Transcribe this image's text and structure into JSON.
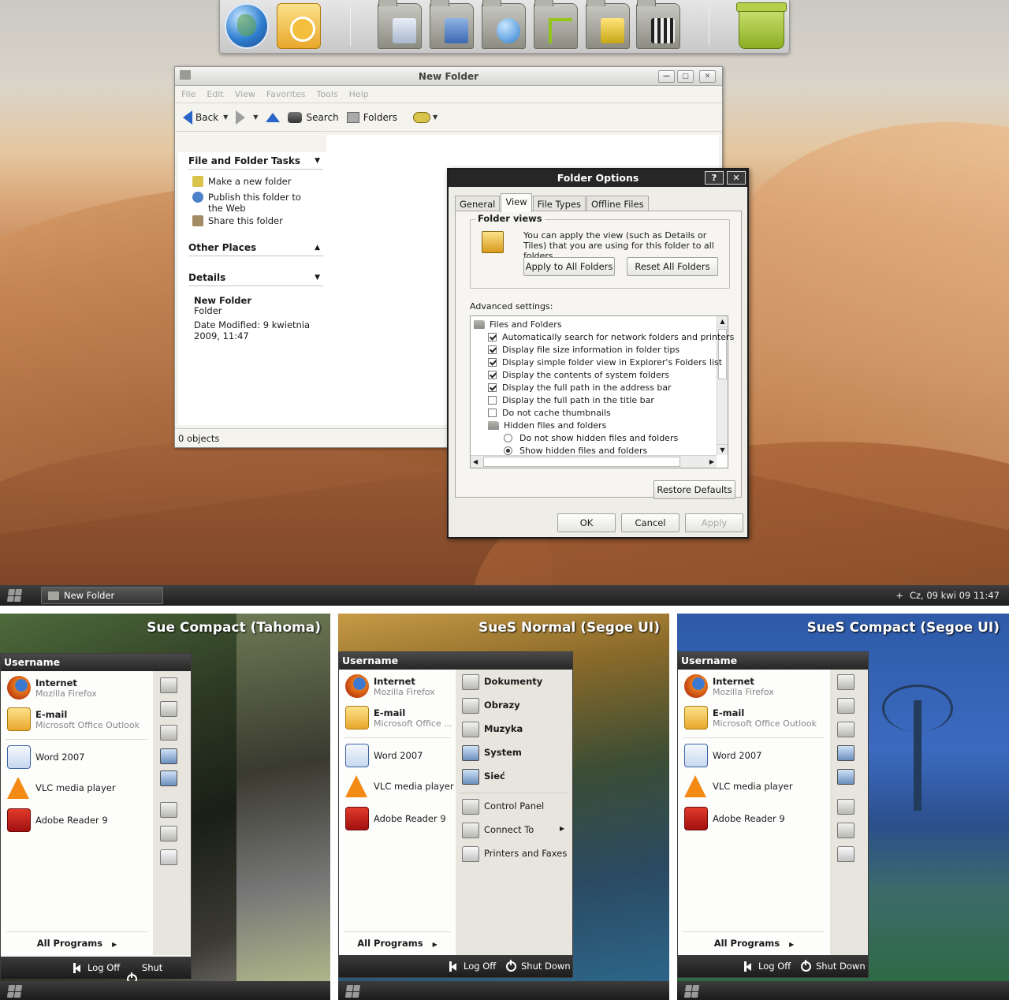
{
  "window": {
    "title": "New Folder",
    "menu": [
      "File",
      "Edit",
      "View",
      "Favorites",
      "Tools",
      "Help"
    ],
    "toolbar": {
      "back": "Back",
      "search": "Search",
      "folders": "Folders"
    },
    "tasks_heading": "File and Folder Tasks",
    "tasks": [
      "Make a new folder",
      "Publish this folder to the Web",
      "Share this folder"
    ],
    "other_places": "Other Places",
    "details_heading": "Details",
    "details": {
      "name": "New Folder",
      "type": "Folder",
      "modified": "Date Modified: 9 kwietnia 2009, 11:47"
    },
    "status": "0 objects"
  },
  "dialog": {
    "title": "Folder Options",
    "help_btn": "?",
    "close_btn": "✕",
    "tabs": [
      "General",
      "View",
      "File Types",
      "Offline Files"
    ],
    "active_tab": "View",
    "folder_views_label": "Folder views",
    "folder_views_text": "You can apply the view (such as Details or Tiles) that you are using for this folder to all folders.",
    "apply_all": "Apply to All Folders",
    "reset_all": "Reset All Folders",
    "advanced_label": "Advanced settings:",
    "advanced": [
      {
        "kind": "folder",
        "text": "Files and Folders"
      },
      {
        "kind": "check",
        "on": true,
        "text": "Automatically search for network folders and printers"
      },
      {
        "kind": "check",
        "on": true,
        "text": "Display file size information in folder tips"
      },
      {
        "kind": "check",
        "on": true,
        "text": "Display simple folder view in Explorer's Folders list"
      },
      {
        "kind": "check",
        "on": true,
        "text": "Display the contents of system folders"
      },
      {
        "kind": "check",
        "on": true,
        "text": "Display the full path in the address bar"
      },
      {
        "kind": "check",
        "on": false,
        "text": "Display the full path in the title bar"
      },
      {
        "kind": "check",
        "on": false,
        "text": "Do not cache thumbnails"
      },
      {
        "kind": "folder",
        "text": "Hidden files and folders"
      },
      {
        "kind": "radio",
        "on": false,
        "text": "Do not show hidden files and folders"
      },
      {
        "kind": "radio",
        "on": true,
        "text": "Show hidden files and folders"
      }
    ],
    "restore": "Restore Defaults",
    "ok": "OK",
    "cancel": "Cancel",
    "apply": "Apply"
  },
  "taskbar": {
    "task": "New Folder",
    "clock": "Cz, 09 kwi 09 11:47",
    "tray_icon": "+"
  },
  "panels": [
    {
      "title": "Sue Compact (Tahoma)",
      "username": "Username",
      "pinned": [
        {
          "name": "Internet",
          "sub": "Mozilla Firefox"
        },
        {
          "name": "E-mail",
          "sub": "Microsoft Office Outlook"
        }
      ],
      "recent": [
        "Word 2007",
        "VLC media player",
        "Adobe Reader 9"
      ],
      "all_programs": "All Programs",
      "log_off": "Log Off",
      "shut_down": "Shut Down"
    },
    {
      "title": "SueS Normal (Segoe UI)",
      "username": "Username",
      "pinned": [
        {
          "name": "Internet",
          "sub": "Mozilla Firefox"
        },
        {
          "name": "E-mail",
          "sub": "Microsoft Office ..."
        }
      ],
      "recent": [
        "Word 2007",
        "VLC media player",
        "Adobe Reader 9"
      ],
      "places": [
        "Dokumenty",
        "Obrazy",
        "Muzyka",
        "System",
        "Sieć"
      ],
      "system": [
        "Control Panel",
        "Connect To",
        "Printers and Faxes"
      ],
      "all_programs": "All Programs",
      "log_off": "Log Off",
      "shut_down": "Shut Down"
    },
    {
      "title": "SueS Compact (Segoe UI)",
      "username": "Username",
      "pinned": [
        {
          "name": "Internet",
          "sub": "Mozilla Firefox"
        },
        {
          "name": "E-mail",
          "sub": "Microsoft Office Outlook"
        }
      ],
      "recent": [
        "Word 2007",
        "VLC media player",
        "Adobe Reader 9"
      ],
      "all_programs": "All Programs",
      "log_off": "Log Off",
      "shut_down": "Shut Down"
    }
  ],
  "colors": {
    "dialog_title": "#262626",
    "taskbar": "#2a2a2a",
    "link_blue": "#2b64c7"
  }
}
